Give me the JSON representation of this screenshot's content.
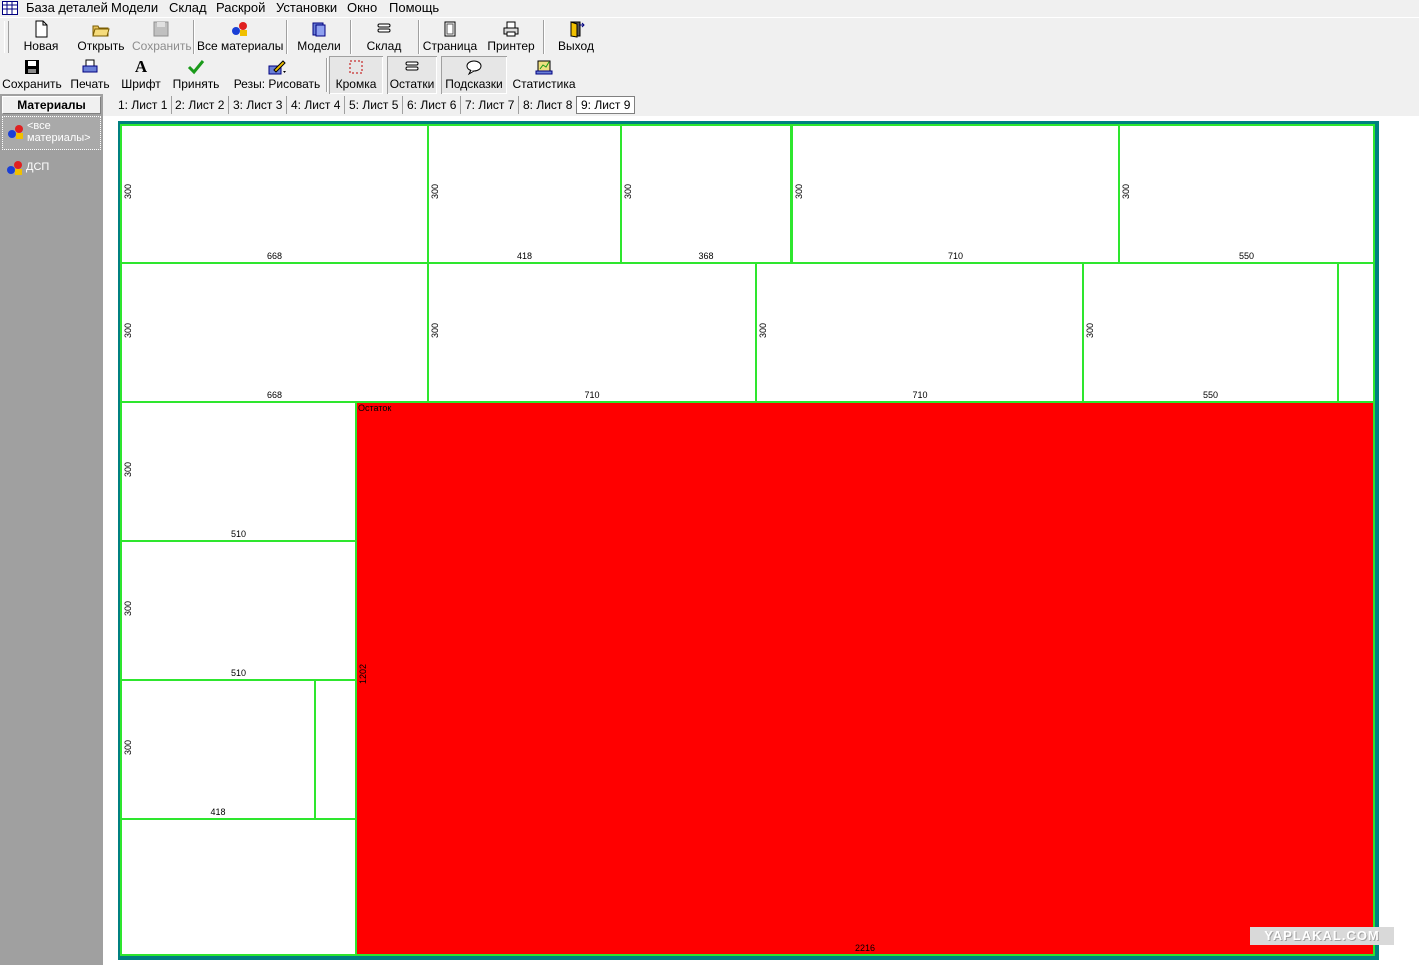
{
  "menu": [
    "База деталей",
    "Модели",
    "Склад",
    "Раскрой",
    "Установки",
    "Окно",
    "Помощь"
  ],
  "toolbar1": {
    "new": "Новая",
    "open": "Открыть",
    "save": "Сохранить",
    "all_materials": "Все материалы",
    "models": "Модели",
    "warehouse": "Склад",
    "page": "Страница",
    "printer": "Принтер",
    "exit": "Выход"
  },
  "toolbar2": {
    "save": "Сохранить",
    "print": "Печать",
    "font": "Шрифт",
    "accept": "Принять",
    "cut_draw": "Резы: Рисовать",
    "edge": "Кромка",
    "remnants": "Остатки",
    "hints": "Подсказки",
    "stats": "Статистика"
  },
  "sidebar": {
    "header": "Материалы",
    "items": [
      {
        "line1": "<все",
        "line2": "материалы>"
      },
      {
        "line1": "ДСП",
        "line2": ""
      }
    ]
  },
  "tabs": [
    "1: Лист 1",
    "2: Лист 2",
    "3: Лист 3",
    "4: Лист 4",
    "5: Лист 5",
    "6: Лист 6",
    "7: Лист 7",
    "8: Лист 8",
    "9: Лист 9"
  ],
  "active_tab": 8,
  "sheet": {
    "parts": [
      {
        "w": "668",
        "h": "300"
      },
      {
        "w": "418",
        "h": "300"
      },
      {
        "w": "368",
        "h": "300"
      },
      {
        "w": "710",
        "h": "300"
      },
      {
        "w": "550",
        "h": "300"
      },
      {
        "w": "668",
        "h": "300"
      },
      {
        "w": "710",
        "h": "300"
      },
      {
        "w": "710",
        "h": "300"
      },
      {
        "w": "550",
        "h": "300"
      },
      {
        "w": "510",
        "h": "300"
      },
      {
        "w": "510",
        "h": "300"
      },
      {
        "w": "418",
        "h": "300"
      }
    ],
    "remnant": {
      "name": "Остаток",
      "w": "2216",
      "h": "1202"
    }
  },
  "watermark": "YAPLAKAL.COM",
  "colors": {
    "part_border": "#2ee62e",
    "remnant_fill": "#ff0000",
    "sheet_bg": "#008080"
  }
}
